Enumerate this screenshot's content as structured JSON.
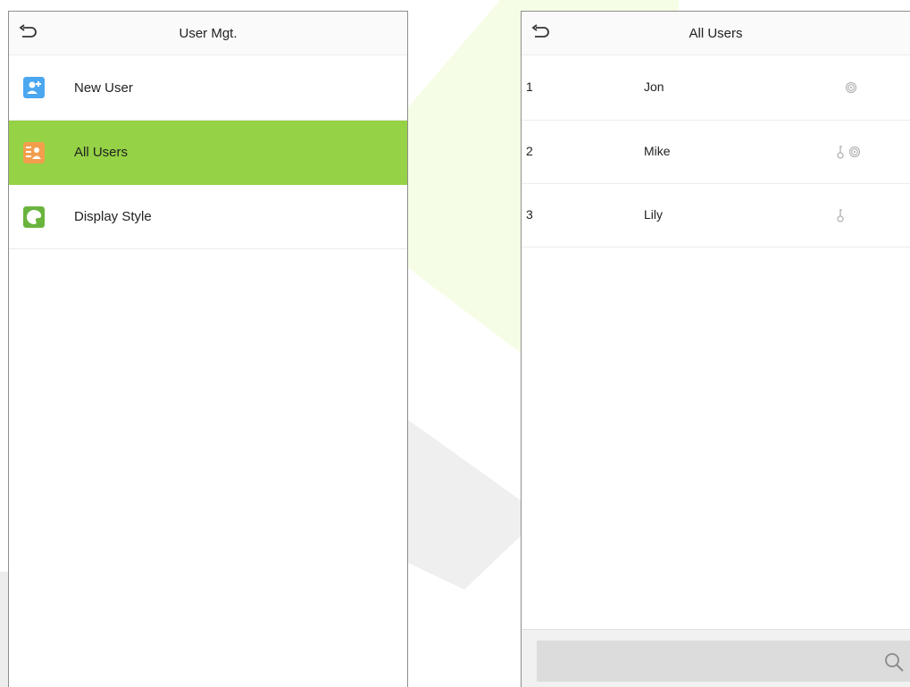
{
  "left_screen": {
    "title": "User Mgt.",
    "menu": [
      {
        "label": "New User",
        "icon": "new-user-icon",
        "color": "#4aa7f0",
        "active": false
      },
      {
        "label": "All Users",
        "icon": "all-users-icon",
        "color": "#f29e4c",
        "active": true
      },
      {
        "label": "Display Style",
        "icon": "display-style-icon",
        "color": "#6ab43e",
        "active": false
      }
    ],
    "active_color": "#95d245"
  },
  "right_screen": {
    "title": "All Users",
    "users": [
      {
        "id": "1",
        "name": "Jon",
        "credentials": [
          "fingerprint-icon"
        ]
      },
      {
        "id": "2",
        "name": "Mike",
        "credentials": [
          "password-icon",
          "fingerprint-icon"
        ]
      },
      {
        "id": "3",
        "name": "Lily",
        "credentials": [
          "password-icon"
        ]
      }
    ],
    "search": {
      "value": "",
      "placeholder": ""
    }
  }
}
